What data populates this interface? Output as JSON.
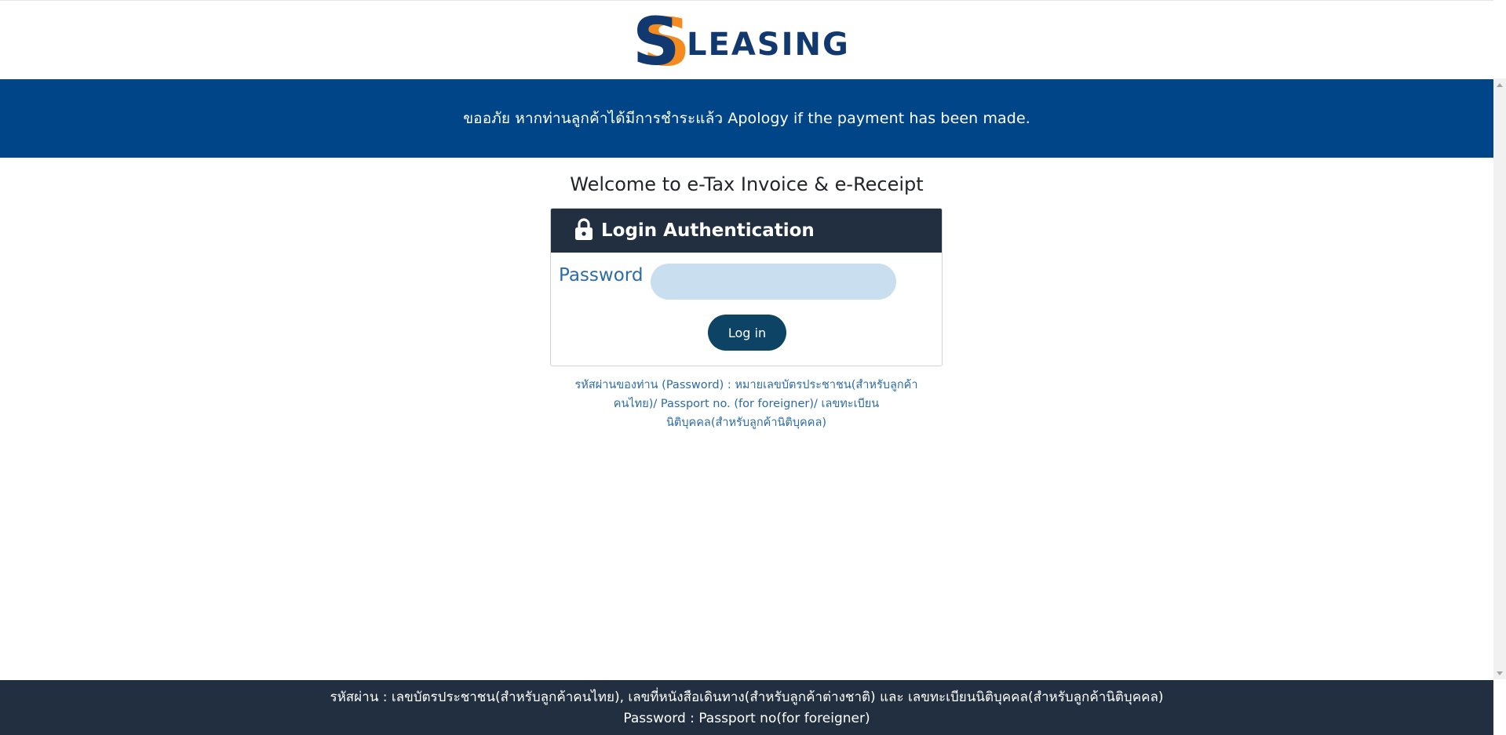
{
  "header": {
    "brand_name": "LEASING",
    "brand_initial": "S",
    "brand_colors": {
      "blue": "#11386f",
      "orange": "#f58a1f"
    }
  },
  "banner": {
    "text": "ขออภัย หากท่านลูกค้าได้มีการชำระแล้ว Apology if the payment has been made."
  },
  "main": {
    "welcome_title": "Welcome to e-Tax Invoice & e-Receipt",
    "card": {
      "icon": "lock-icon",
      "title": "Login Authentication",
      "password_label": "Password",
      "password_value": "",
      "password_placeholder": "",
      "login_label": "Log in"
    },
    "hint_lines": [
      "รหัสผ่านของท่าน (Password) : หมายเลขบัตรประชาชน(สำหรับลูกค้า",
      "คนไทย)/ Passport no. (for foreigner)/ เลขทะเบียน",
      "นิติบุคคล(สำหรับลูกค้านิติบุคคล)"
    ]
  },
  "footer": {
    "line1": "รหัสผ่าน : เลขบัตรประชาชน(สำหรับลูกค้าคนไทย), เลขที่หนังสือเดินทาง(สำหรับลูกค้าต่างชาติ) และ เลขทะเบียนนิติบุคคล(สำหรับลูกค้านิติบุคคล)",
    "line2": "Password : Passport no(for foreigner)"
  },
  "colors": {
    "banner_bg": "#004587",
    "card_header_bg": "#212f40",
    "footer_bg": "#212f40",
    "accent_text": "#2c6ba4",
    "input_bg": "#c9deee",
    "button_bg": "#0d4466"
  }
}
